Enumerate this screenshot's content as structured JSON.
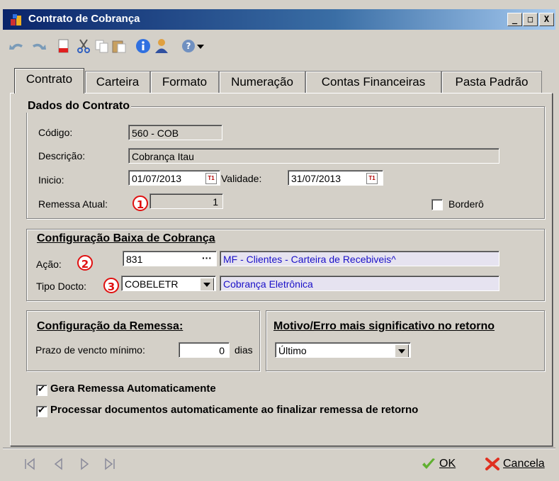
{
  "window": {
    "title": "Contrato de Cobrança",
    "controls": [
      "_",
      "□",
      "X"
    ]
  },
  "toolbar": {
    "icons": [
      "undo-icon",
      "redo-icon",
      "new-document-icon",
      "cut-icon",
      "copy-icon",
      "paste-icon",
      "info-icon",
      "user-icon",
      "help-icon",
      "dropdown-arrow-icon"
    ]
  },
  "tabs": [
    {
      "label": "Contrato",
      "active": true
    },
    {
      "label": "Carteira"
    },
    {
      "label": "Formato"
    },
    {
      "label": "Numeração"
    },
    {
      "label": "Contas Financeiras"
    },
    {
      "label": "Pasta Padrão"
    }
  ],
  "dados_contrato": {
    "title": "Dados do Contrato",
    "codigo_label": "Código:",
    "codigo_value": "560 - COB",
    "descricao_label": "Descrição:",
    "descricao_value": "Cobrança Itau",
    "inicio_label": "Inicio:",
    "inicio_value": "01/07/2013",
    "validade_label": "Validade:",
    "validade_value": "31/07/2013",
    "remessa_label": "Remessa Atual:",
    "remessa_value": "1",
    "bordero_label": "Borderô",
    "bordero_checked": false,
    "calendar_glyph": "T1"
  },
  "baixa": {
    "title": "Configuração Baixa de Cobrança",
    "acao_label": "Ação:",
    "acao_code": "831",
    "acao_ellipsis": "···",
    "acao_desc": "MF - Clientes - Carteira de Recebiveis^",
    "tipo_label": "Tipo Docto:",
    "tipo_value": "COBELETR",
    "tipo_desc": "Cobrança Eletrônica"
  },
  "remessa_cfg": {
    "title": "Configuração da Remessa:",
    "prazo_label": "Prazo de vencto mínimo:",
    "prazo_value": "0",
    "dias_label": "dias"
  },
  "motivo": {
    "title": "Motivo/Erro mais significativo no retorno",
    "selected": "Último"
  },
  "options": {
    "gera_label": "Gera Remessa Automaticamente",
    "gera_checked": true,
    "processar_label": "Processar documentos automaticamente ao finalizar remessa de retorno",
    "processar_checked": true
  },
  "badges": [
    "1",
    "2",
    "3"
  ],
  "footer": {
    "ok_label": "OK",
    "cancel_label": "Cancela"
  },
  "colors": {
    "window_bg": "#d4d0c8",
    "titlebar": "#0a246a",
    "lookup_text": "#1a10c8",
    "badge": "#e01010"
  }
}
